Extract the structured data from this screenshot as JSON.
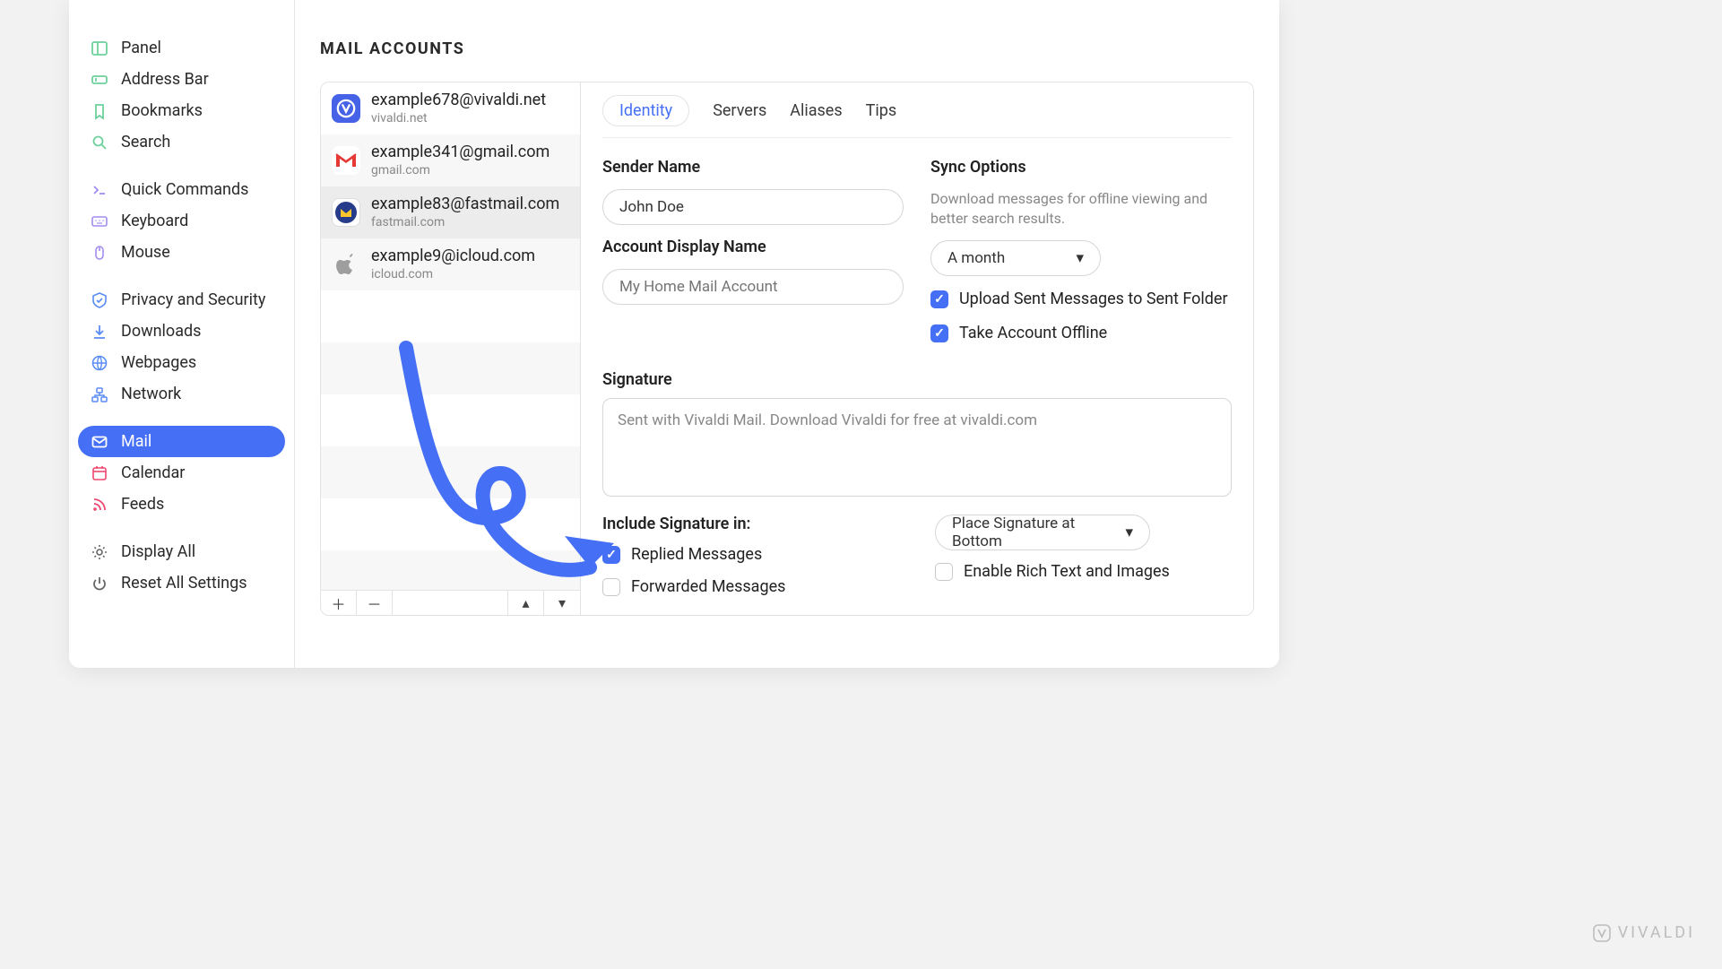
{
  "sidebar": {
    "items": [
      {
        "key": "panel",
        "label": "Panel"
      },
      {
        "key": "addressbar",
        "label": "Address Bar"
      },
      {
        "key": "bookmarks",
        "label": "Bookmarks"
      },
      {
        "key": "search",
        "label": "Search"
      },
      {
        "key": "quickcmd",
        "label": "Quick Commands"
      },
      {
        "key": "keyboard",
        "label": "Keyboard"
      },
      {
        "key": "mouse",
        "label": "Mouse"
      },
      {
        "key": "privacy",
        "label": "Privacy and Security"
      },
      {
        "key": "downloads",
        "label": "Downloads"
      },
      {
        "key": "webpages",
        "label": "Webpages"
      },
      {
        "key": "network",
        "label": "Network"
      },
      {
        "key": "mail",
        "label": "Mail"
      },
      {
        "key": "calendar",
        "label": "Calendar"
      },
      {
        "key": "feeds",
        "label": "Feeds"
      },
      {
        "key": "displayall",
        "label": "Display All"
      },
      {
        "key": "reset",
        "label": "Reset All Settings"
      }
    ]
  },
  "page_title": "MAIL ACCOUNTS",
  "accounts": [
    {
      "email": "example678@vivaldi.net",
      "domain": "vivaldi.net",
      "provider": "vivaldi"
    },
    {
      "email": "example341@gmail.com",
      "domain": "gmail.com",
      "provider": "gmail"
    },
    {
      "email": "example83@fastmail.com",
      "domain": "fastmail.com",
      "provider": "fastmail"
    },
    {
      "email": "example9@icloud.com",
      "domain": "icloud.com",
      "provider": "icloud"
    }
  ],
  "tabs": [
    "Identity",
    "Servers",
    "Aliases",
    "Tips"
  ],
  "identity": {
    "sender_name_label": "Sender Name",
    "sender_name_value": "John Doe",
    "display_name_label": "Account Display Name",
    "display_name_placeholder": "My Home Mail Account",
    "sync_label": "Sync Options",
    "sync_desc": "Download messages for offline viewing and better search results.",
    "sync_select": "A month",
    "upload_sent": "Upload Sent Messages to Sent Folder",
    "take_offline": "Take Account Offline",
    "signature_label": "Signature",
    "signature_text": "Sent with Vivaldi Mail. Download Vivaldi for free at vivaldi.com",
    "include_label": "Include Signature in:",
    "replied": "Replied Messages",
    "forwarded": "Forwarded Messages",
    "place_select": "Place Signature at Bottom",
    "rich_text": "Enable Rich Text and Images"
  },
  "brand": "VIVALDI"
}
